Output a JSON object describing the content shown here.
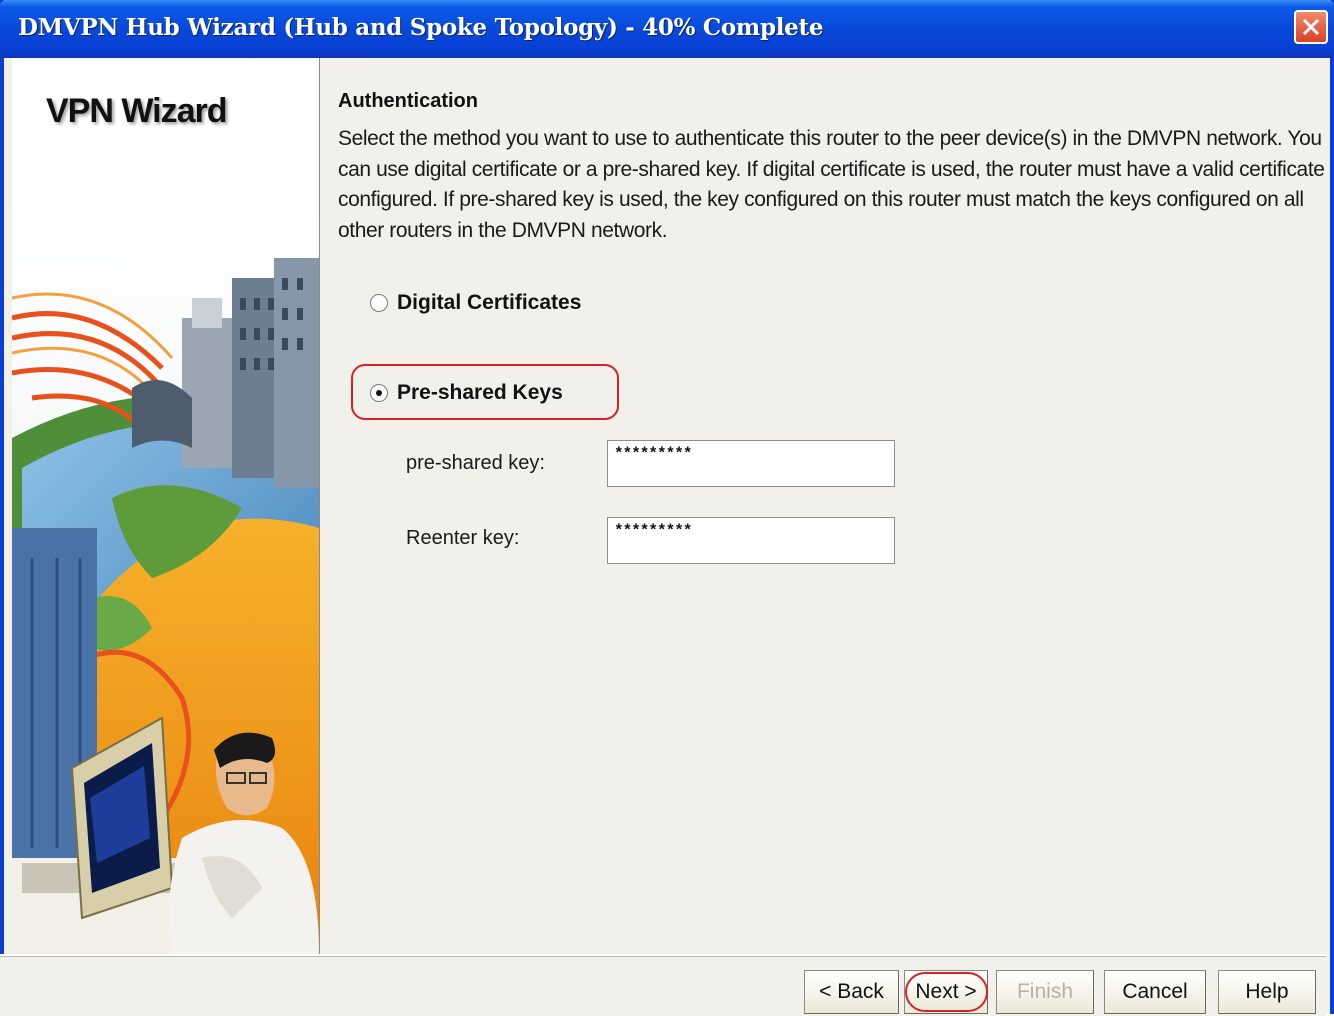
{
  "window": {
    "title": "DMVPN Hub Wizard (Hub and Spoke Topology) - 40% Complete"
  },
  "sidebar": {
    "wizard_title": "VPN Wizard"
  },
  "main": {
    "heading": "Authentication",
    "description": "Select the method you want to use to authenticate this router to the peer device(s) in the DMVPN network. You can use digital certificate or a pre-shared key. If digital certificate is used, the router must have a valid certificate configured. If pre-shared key is used, the key configured on this router must match the keys configured on all other routers in the DMVPN network.",
    "options": [
      {
        "label": "Digital Certificates",
        "selected": false
      },
      {
        "label": "Pre-shared Keys",
        "selected": true
      }
    ],
    "fields": {
      "preshared_label": "pre-shared key:",
      "preshared_value": "*********",
      "reenter_label": "Reenter key:",
      "reenter_value": "*********"
    }
  },
  "buttons": {
    "back": "< Back",
    "next": "Next >",
    "finish": "Finish",
    "cancel": "Cancel",
    "help": "Help"
  },
  "colors": {
    "titlebar": "#0a3fd4",
    "highlight": "#d2232a",
    "background": "#f1f0ea"
  },
  "icons": {
    "close": "close-icon",
    "illustration": "vpn-wizard-illustration"
  }
}
